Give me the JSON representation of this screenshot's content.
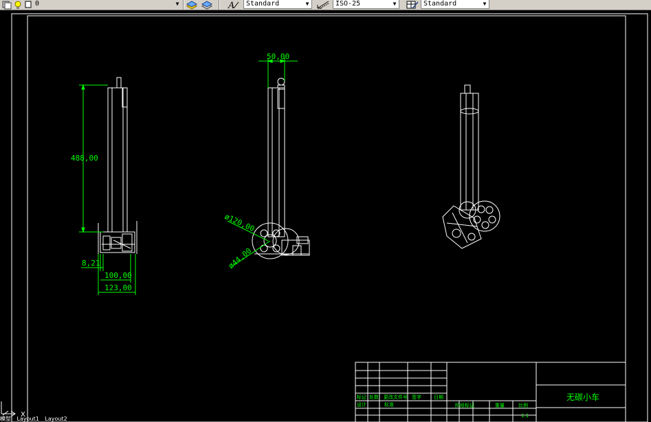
{
  "toolbar": {
    "layer_value": "0",
    "text_style": "Standard",
    "dim_style": "ISO-25",
    "table_style": "Standard"
  },
  "dimensions": {
    "height": "488,00",
    "top_width": "50,00",
    "dia_large": "ø120,00",
    "dia_small": "ø44,00",
    "offset": "8,21",
    "width_inner": "100,00",
    "width_outer": "123,00"
  },
  "title_block": {
    "drawing_title": "无碳小车",
    "row_labels": [
      "标记",
      "处数",
      "更改文件号",
      "签字",
      "日期"
    ],
    "row_labels2": [
      "设计",
      "标准"
    ],
    "stage_labels": [
      "阶段标记",
      "重量",
      "比例"
    ],
    "scale": "1:1"
  },
  "ucs": {
    "x_label": "X"
  },
  "tabs": [
    "模型",
    "Layout1",
    "Layout2"
  ],
  "colors": {
    "background": "#000000",
    "lines": "#ffffff",
    "dimensions": "#00ff00",
    "toolbar": "#d4d0c8"
  }
}
